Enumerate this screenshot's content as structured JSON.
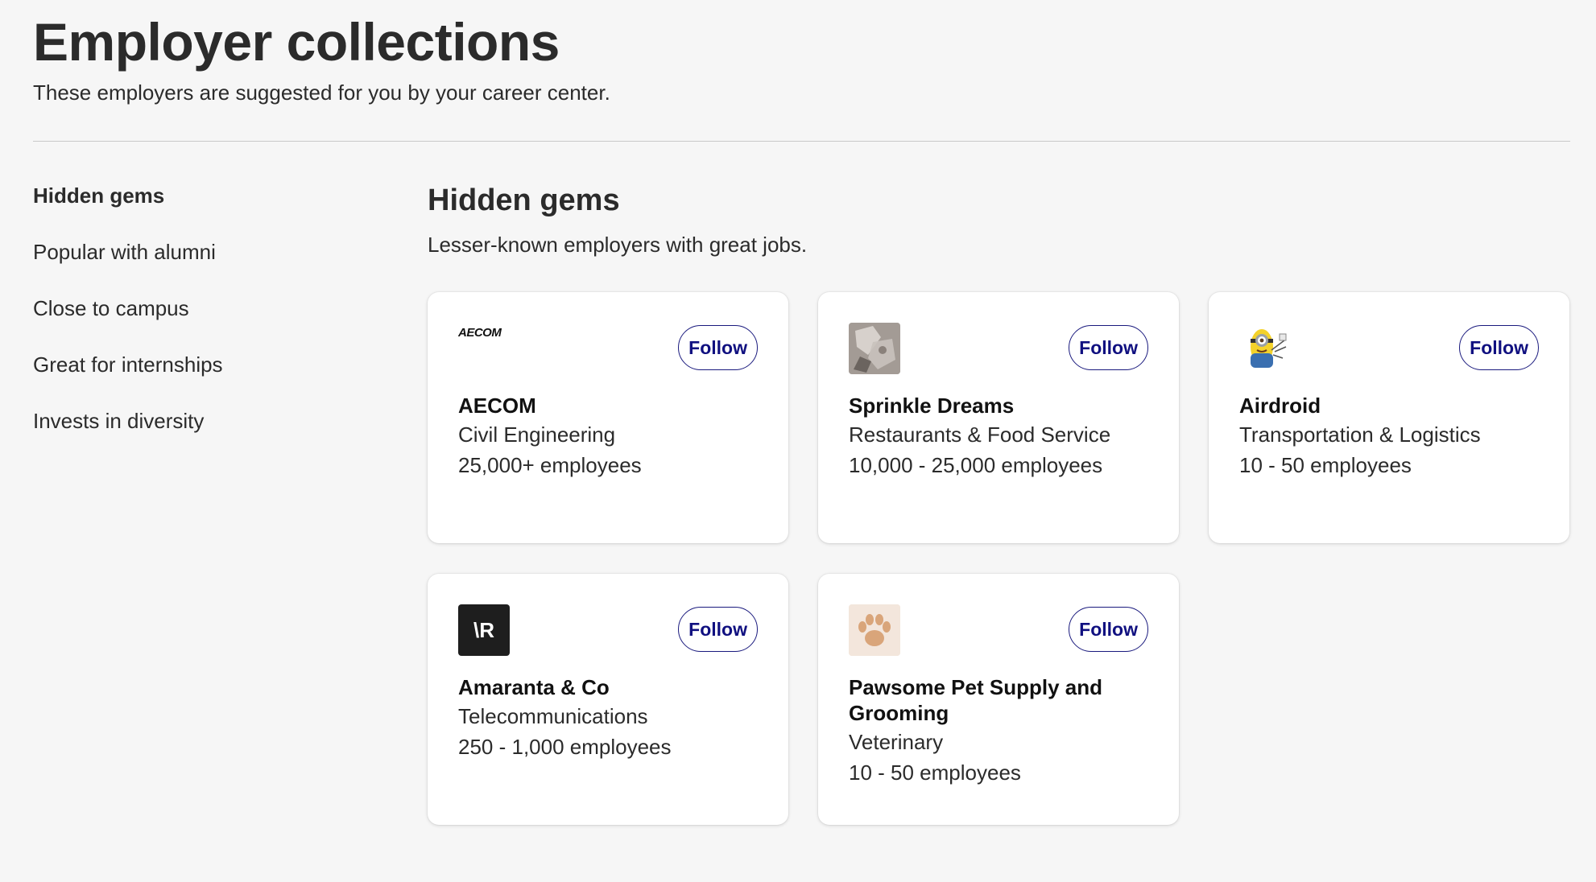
{
  "header": {
    "title": "Employer collections",
    "subtitle": "These employers are suggested for you by your career center."
  },
  "sidebar": {
    "items": [
      {
        "label": "Hidden gems",
        "active": true
      },
      {
        "label": "Popular with alumni",
        "active": false
      },
      {
        "label": "Close to campus",
        "active": false
      },
      {
        "label": "Great for internships",
        "active": false
      },
      {
        "label": "Invests in diversity",
        "active": false
      }
    ]
  },
  "section": {
    "title": "Hidden gems",
    "subtitle": "Lesser-known employers with great jobs."
  },
  "employers": [
    {
      "name": "AECOM",
      "industry": "Civil Engineering",
      "size": "25,000+ employees",
      "follow_label": "Follow",
      "logo": {
        "icon": "aecom-logo",
        "text": "AECOM"
      }
    },
    {
      "name": "Sprinkle Dreams",
      "industry": "Restaurants & Food Service",
      "size": "10,000 - 25,000 employees",
      "follow_label": "Follow",
      "logo": {
        "icon": "sprinkle-dreams-logo"
      }
    },
    {
      "name": "Airdroid",
      "industry": "Transportation & Logistics",
      "size": "10 - 50 employees",
      "follow_label": "Follow",
      "logo": {
        "icon": "minion-logo"
      }
    },
    {
      "name": "Amaranta & Co",
      "industry": "Telecommunications",
      "size": "250 - 1,000 employees",
      "follow_label": "Follow",
      "logo": {
        "icon": "amaranta-logo",
        "text": "\\R"
      }
    },
    {
      "name": "Pawsome Pet Supply and Grooming",
      "industry": "Veterinary",
      "size": "10 - 50 employees",
      "follow_label": "Follow",
      "logo": {
        "icon": "paw-logo"
      }
    }
  ],
  "colors": {
    "background": "#f6f6f6",
    "card": "#ffffff",
    "text": "#2b2b2b",
    "follow_accent": "#101080",
    "divider": "#c9c9c9"
  }
}
